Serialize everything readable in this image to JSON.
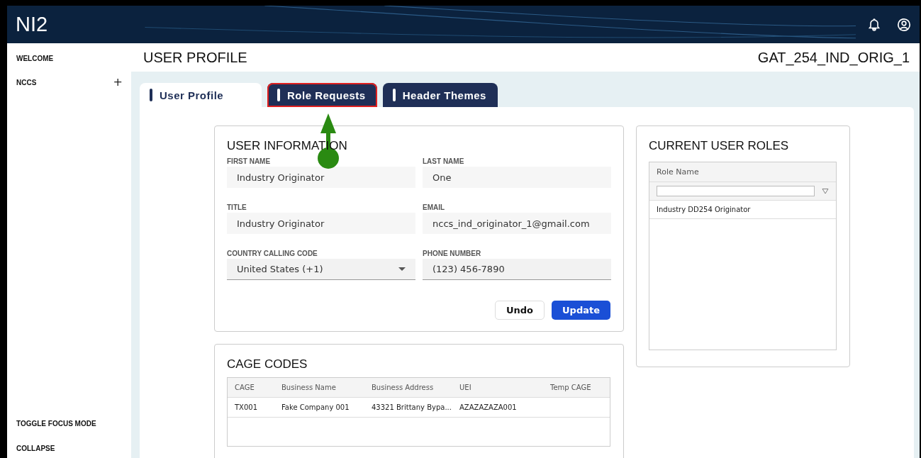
{
  "app": {
    "logo": "NI2"
  },
  "sidebar": {
    "items": [
      {
        "label": "WELCOME"
      },
      {
        "label": "NCCS",
        "expand_icon": "+"
      }
    ],
    "footer_items": [
      "TOGGLE FOCUS MODE",
      "COLLAPSE"
    ]
  },
  "page": {
    "title": "USER PROFILE",
    "username": "GAT_254_IND_ORIG_1"
  },
  "tabs": [
    {
      "label": "User Profile",
      "selected": true,
      "highlighted": false
    },
    {
      "label": "Role Requests",
      "selected": false,
      "highlighted": true
    },
    {
      "label": "Header Themes",
      "selected": false,
      "highlighted": false
    }
  ],
  "user_information": {
    "title": "USER INFORMATION",
    "fields": [
      {
        "label": "FIRST NAME",
        "value": "Industry Originator",
        "kind": "text"
      },
      {
        "label": "LAST NAME",
        "value": "One",
        "kind": "text"
      },
      {
        "label": "TITLE",
        "value": "Industry Originator",
        "kind": "text"
      },
      {
        "label": "EMAIL",
        "value": "nccs_ind_originator_1@gmail.com",
        "kind": "text"
      },
      {
        "label": "COUNTRY CALLING CODE",
        "value": "United States (+1)",
        "kind": "select"
      },
      {
        "label": "PHONE NUMBER",
        "value": "(123) 456-7890",
        "kind": "input"
      }
    ],
    "buttons": [
      {
        "label": "Undo",
        "kind": "secondary"
      },
      {
        "label": "Update",
        "kind": "primary"
      }
    ]
  },
  "current_user_roles": {
    "title": "CURRENT USER ROLES",
    "columns": [
      "Role Name"
    ],
    "rows": [
      "Industry DD254 Originator"
    ]
  },
  "cage_codes": {
    "title": "CAGE CODES",
    "columns": [
      "CAGE",
      "Business Name",
      "Business Address",
      "UEI",
      "Temp CAGE"
    ],
    "rows": [
      [
        "TX001",
        "Fake Company 001",
        "43321 Brittany Bypa...",
        "AZAZAZAZA001",
        null
      ]
    ]
  }
}
